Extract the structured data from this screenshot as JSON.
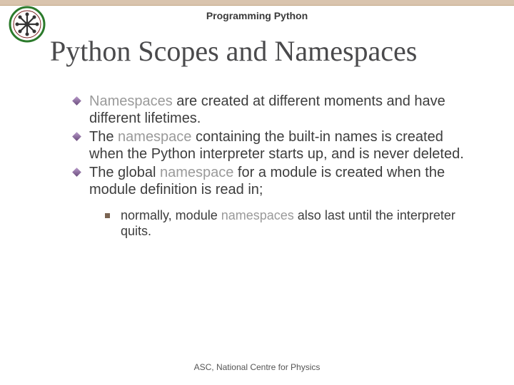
{
  "header": {
    "subtitle": "Programming Python"
  },
  "title": "Python Scopes and Namespaces",
  "bullets": [
    {
      "kw": "Namespaces",
      "rest": " are created at different moments and have different lifetimes."
    },
    {
      "pre": "The ",
      "kw": "namespace",
      "rest": " containing the built-in names is created when the Python interpreter starts up, and is never deleted."
    },
    {
      "pre": "The global ",
      "kw": "namespace",
      "rest": " for a module is created when the module definition is read in;"
    }
  ],
  "sub": {
    "pre": "normally, module ",
    "kw": "namespaces",
    "rest": " also last until the interpreter quits."
  },
  "footer": "ASC, National Centre for Physics"
}
